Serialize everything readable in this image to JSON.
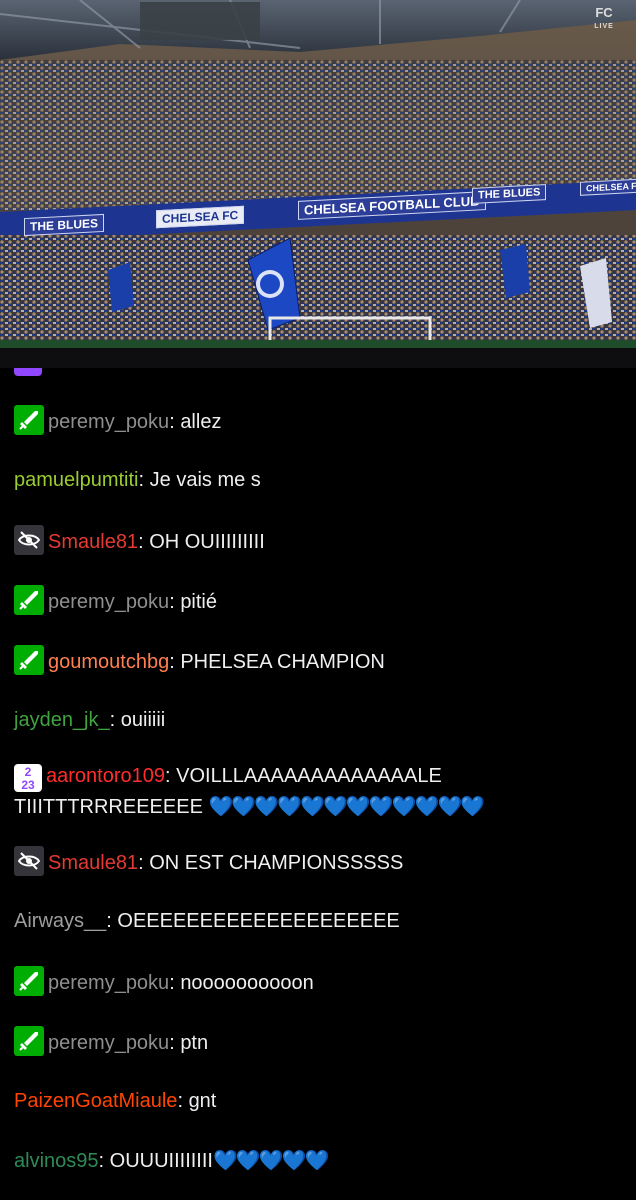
{
  "video": {
    "live_badge": "LIVE",
    "ea_logo": "FC",
    "ads": [
      "THE BLUES",
      "CHELSEA FC",
      "CHELSEA FOOTBALL CLUB",
      "THE BLUES",
      "CHELSEA FC"
    ]
  },
  "chat": {
    "messages": [
      {
        "badge": "mod-sword-icon",
        "user": "peremy_poku",
        "color": "#8f8f8f",
        "text": "allez"
      },
      {
        "badge": "",
        "user": "pamuelpumtiti",
        "color": "#9acd32",
        "text": "Je vais me s"
      },
      {
        "badge": "blind-icon",
        "user": "Smaule81",
        "color": "#e53935",
        "text": "OH OUIIIIIIIII"
      },
      {
        "badge": "mod-sword-icon",
        "user": "peremy_poku",
        "color": "#8f8f8f",
        "text": "pitié"
      },
      {
        "badge": "mod-sword-icon",
        "user": "goumoutchbg",
        "color": "#ff7f50",
        "text": "PHELSEA CHAMPION"
      },
      {
        "badge": "",
        "user": "jayden_jk_",
        "color": "#3fa33f",
        "text": "ouiiiii"
      },
      {
        "badge": "sub-2023-icon",
        "user": "aarontoro109",
        "color": "#ff2d2d",
        "text": "VOILLLAAAAAAAAAAAAALE",
        "text2": "TIIITTTRRREEEEEE",
        "hearts": "💙💙💙💙💙💙💙💙💙💙💙💙"
      },
      {
        "badge": "blind-icon",
        "user": "Smaule81",
        "color": "#e53935",
        "text": "ON EST CHAMPIONSSSSS"
      },
      {
        "badge": "",
        "user": "Airways__",
        "color": "#9e9e9e",
        "text": "OEEEEEEEEEEEEEEEEEEEE"
      },
      {
        "badge": "mod-sword-icon",
        "user": "peremy_poku",
        "color": "#8f8f8f",
        "text": "noooooooooon"
      },
      {
        "badge": "mod-sword-icon",
        "user": "peremy_poku",
        "color": "#8f8f8f",
        "text": "ptn"
      },
      {
        "badge": "",
        "user": "PaizenGoatMiaule",
        "color": "#ff4500",
        "text": "gnt"
      },
      {
        "badge": "",
        "user": "alvinos95",
        "color": "#2e8b57",
        "text": "OUUUIIIIIIII",
        "hearts": "💙💙💙💙💙"
      }
    ]
  },
  "sub_badge": {
    "top": "2",
    "bottom": "23"
  },
  "colors": {
    "mod": "#00ad03",
    "background": "#000000",
    "heart": "#2f9fe8"
  }
}
